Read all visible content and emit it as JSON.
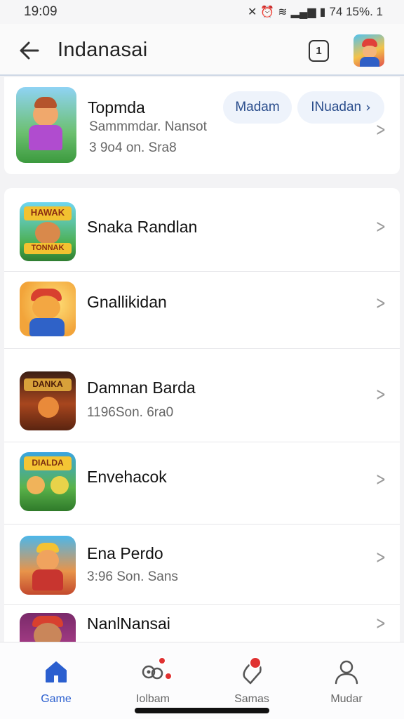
{
  "status_bar": {
    "time": "19:09",
    "right_text": "74 15%. 1"
  },
  "app_bar": {
    "title": "Indanasai",
    "counter": "1"
  },
  "top_card": {
    "name": "Topmda",
    "subtitle": "Sammmdar. Nansot",
    "meta": "3 9o4 on. Sra8",
    "pill_1": "Madam",
    "pill_2": "INuadan"
  },
  "games": [
    {
      "name": "Snaka Randlan",
      "sub": ""
    },
    {
      "name": "Gnallikidan",
      "sub": ""
    },
    {
      "name": "Damnan Barda",
      "sub": "1196Son. 6ra0"
    },
    {
      "name": "Envehacok",
      "sub": ""
    },
    {
      "name": "Ena Perdo",
      "sub": "3:96 Son. Sans"
    },
    {
      "name": "NanlNansai",
      "sub": ""
    }
  ],
  "icon_banners": {
    "game_1": "HAWAK",
    "game_1_bottom": "TONNAK",
    "game_3": "DANKA",
    "game_4": "DIALDA"
  },
  "bottom_nav": [
    {
      "label": "Game",
      "icon": "home-icon",
      "active": true
    },
    {
      "label": "Iolbam",
      "icon": "controller-icon",
      "active": false
    },
    {
      "label": "Samas",
      "icon": "shield-icon",
      "active": false
    },
    {
      "label": "Mudar",
      "icon": "person-icon",
      "active": false
    }
  ],
  "colors": {
    "accent": "#2b5fcf",
    "badge": "#e03131",
    "pill_bg": "#eef3fb"
  }
}
